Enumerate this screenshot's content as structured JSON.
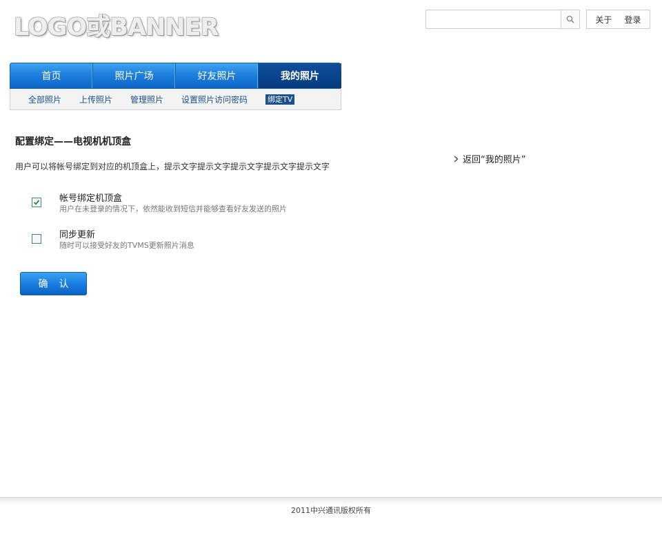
{
  "header": {
    "logo_text": "LOGO或BANNER",
    "search_placeholder": "",
    "search_value": "",
    "links": [
      "关于",
      "登录"
    ]
  },
  "nav": {
    "items": [
      "首页",
      "照片广场",
      "好友照片",
      "我的照片"
    ],
    "active_index": 3
  },
  "subnav": {
    "items": [
      "全部照片",
      "上传照片",
      "管理照片",
      "设置照片访问密码",
      "绑定TV"
    ],
    "active_index": 4
  },
  "content": {
    "title": "配置绑定——电视机机顶盒",
    "intro": "用户可以将帐号绑定到对应的机顶盒上，提示文字提示文字提示文字提示文字提示文字",
    "back_link": "返回“我的照片”",
    "options": [
      {
        "title": "帐号绑定机顶盒",
        "description": "用户在未登录的情况下，依然能收到短信并能够查看好友发送的照片",
        "checked": true
      },
      {
        "title": "同步更新",
        "description": "随时可以接受好友的TVMS更新照片消息",
        "checked": false
      }
    ],
    "confirm_label": "确认"
  },
  "footer": {
    "copyright": "2011中兴通讯版权所有"
  },
  "colors": {
    "nav_blue": "#1b7ddd",
    "nav_active": "#0a4489",
    "subnav_link": "#1a4f8f",
    "checkbox_check": "#2e8b2e"
  }
}
